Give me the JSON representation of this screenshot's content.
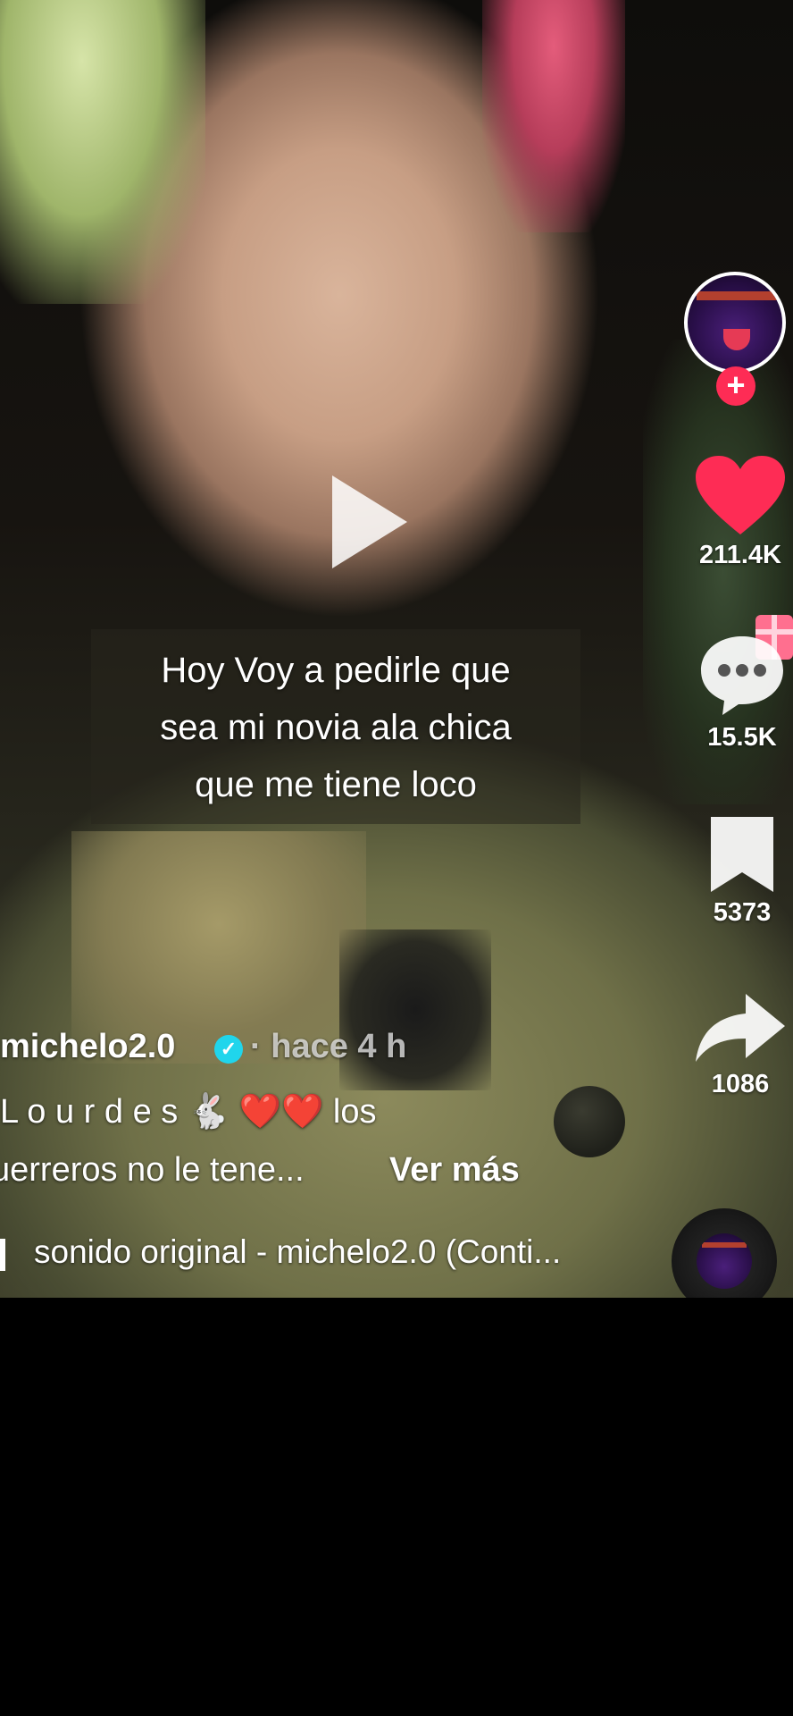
{
  "caption": {
    "lines": [
      "Hoy Voy a pedirle que",
      "sea mi novia ala chica",
      "que me tiene loco"
    ]
  },
  "sidebar": {
    "likes": "211.4K",
    "comments": "15.5K",
    "saves": "5373",
    "shares": "1086"
  },
  "post": {
    "username": "michelo2.0",
    "time_ago": "· hace 4 h",
    "description_line1": "L o u r d e s 🐇 ❤️❤️ los",
    "description_line2": "uerreros no le tene...",
    "see_more": "Ver más",
    "music": "sonido original - michelo2.0 (Conti..."
  },
  "colors": {
    "like": "#fe2c55",
    "follow": "#fe2c55",
    "verified": "#20d5ec"
  },
  "icons": [
    "play-icon",
    "heart-icon",
    "comment-icon",
    "bookmark-icon",
    "share-icon",
    "gift-icon",
    "music-note-icon",
    "verified-icon",
    "plus-icon"
  ]
}
